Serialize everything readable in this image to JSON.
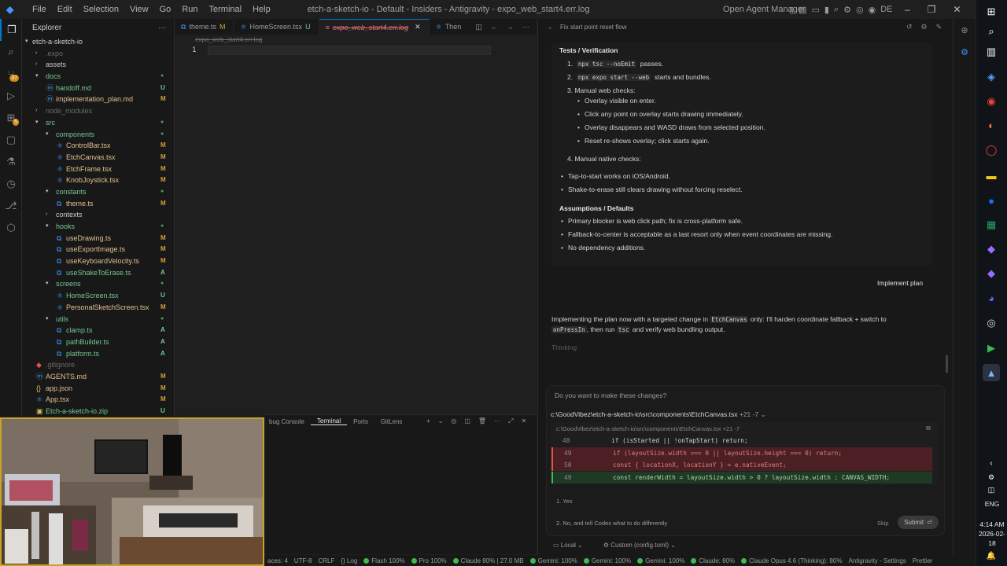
{
  "titlebar": {
    "menu": [
      "File",
      "Edit",
      "Selection",
      "View",
      "Go",
      "Run",
      "Terminal",
      "Help"
    ],
    "title": "etch-a-sketch-io - Default - Insiders - Antigravity - expo_web_start4.err.log",
    "agent_manager": "Open Agent Manager",
    "user_initials": "DE"
  },
  "explorer": {
    "header": "Explorer",
    "root": "etch-a-sketch-io",
    "rows": [
      {
        "label": ".expo",
        "depth": 1,
        "kind": "folder",
        "collapsed": true,
        "dim": true,
        "status": ""
      },
      {
        "label": "assets",
        "depth": 1,
        "kind": "folder",
        "collapsed": true,
        "dim": false,
        "status": ""
      },
      {
        "label": "docs",
        "depth": 1,
        "kind": "folder",
        "collapsed": false,
        "dim": false,
        "status": "dot"
      },
      {
        "label": "handoff.md",
        "depth": 2,
        "kind": "md",
        "status": "U"
      },
      {
        "label": "implementation_plan.md",
        "depth": 2,
        "kind": "md",
        "status": "M"
      },
      {
        "label": "node_modules",
        "depth": 1,
        "kind": "folder",
        "collapsed": true,
        "dim": true,
        "status": ""
      },
      {
        "label": "src",
        "depth": 1,
        "kind": "folder",
        "collapsed": false,
        "dim": false,
        "status": "dot"
      },
      {
        "label": "components",
        "depth": 2,
        "kind": "folder",
        "collapsed": false,
        "status": "dot"
      },
      {
        "label": "ControlBar.tsx",
        "depth": 3,
        "kind": "tsx",
        "status": "M"
      },
      {
        "label": "EtchCanvas.tsx",
        "depth": 3,
        "kind": "tsx",
        "status": "M"
      },
      {
        "label": "EtchFrame.tsx",
        "depth": 3,
        "kind": "tsx",
        "status": "M"
      },
      {
        "label": "KnobJoystick.tsx",
        "depth": 3,
        "kind": "tsx",
        "status": "M"
      },
      {
        "label": "constants",
        "depth": 2,
        "kind": "folder",
        "collapsed": false,
        "status": "dot"
      },
      {
        "label": "theme.ts",
        "depth": 3,
        "kind": "ts",
        "status": "M"
      },
      {
        "label": "contexts",
        "depth": 2,
        "kind": "folder",
        "collapsed": true,
        "status": ""
      },
      {
        "label": "hooks",
        "depth": 2,
        "kind": "folder",
        "collapsed": false,
        "status": "dot"
      },
      {
        "label": "useDrawing.ts",
        "depth": 3,
        "kind": "ts",
        "status": "M"
      },
      {
        "label": "useExportImage.ts",
        "depth": 3,
        "kind": "ts",
        "status": "M"
      },
      {
        "label": "useKeyboardVelocity.ts",
        "depth": 3,
        "kind": "ts",
        "status": "M"
      },
      {
        "label": "useShakeToErase.ts",
        "depth": 3,
        "kind": "ts",
        "status": "A"
      },
      {
        "label": "screens",
        "depth": 2,
        "kind": "folder",
        "collapsed": false,
        "status": "dot"
      },
      {
        "label": "HomeScreen.tsx",
        "depth": 3,
        "kind": "tsx",
        "status": "U"
      },
      {
        "label": "PersonalSketchScreen.tsx",
        "depth": 3,
        "kind": "tsx",
        "status": "M"
      },
      {
        "label": "utils",
        "depth": 2,
        "kind": "folder",
        "collapsed": false,
        "status": "dot"
      },
      {
        "label": "clamp.ts",
        "depth": 3,
        "kind": "ts",
        "status": "A"
      },
      {
        "label": "pathBuilder.ts",
        "depth": 3,
        "kind": "ts",
        "status": "A"
      },
      {
        "label": "platform.ts",
        "depth": 3,
        "kind": "ts",
        "status": "A"
      },
      {
        "label": ".gitignore",
        "depth": 1,
        "kind": "git",
        "dim": true,
        "status": ""
      },
      {
        "label": "AGENTS.md",
        "depth": 1,
        "kind": "md",
        "status": "M"
      },
      {
        "label": "app.json",
        "depth": 1,
        "kind": "json",
        "status": "M"
      },
      {
        "label": "App.tsx",
        "depth": 1,
        "kind": "tsx",
        "status": "M"
      },
      {
        "label": "Etch-a-sketch-io.zip",
        "depth": 1,
        "kind": "zip",
        "status": "U"
      }
    ]
  },
  "tabs": [
    {
      "label": "theme.ts",
      "status": "M",
      "icon": "ts-icon",
      "active": false
    },
    {
      "label": "HomeScreen.tsx",
      "status": "U",
      "icon": "react-icon",
      "active": false
    },
    {
      "label": "expo_web_start4.err.log",
      "status": "",
      "icon": "log-icon",
      "active": true
    },
    {
      "label": "Then",
      "status": "",
      "icon": "react-icon",
      "active": false
    }
  ],
  "editor": {
    "breadcrumb": "expo_web_start4.err.log",
    "line_number": "1"
  },
  "panel": {
    "tabs": [
      "bug Console",
      "Terminal",
      "Ports",
      "GitLens"
    ],
    "active_tab": "Terminal"
  },
  "agent": {
    "header": "Fix start point reset flow",
    "plan": {
      "tests_heading": "Tests / Verification",
      "test1_code": "npx tsc --noEmit",
      "test1_text": "passes.",
      "test2_code": "npx expo start --web",
      "test2_text": "starts and bundles.",
      "test3": "Manual web checks:",
      "web_checks": [
        "Overlay visible on enter.",
        "Click any point on overlay starts drawing immediately.",
        "Overlay disappears and WASD draws from selected position.",
        "Reset re-shows overlay; click starts again."
      ],
      "test4": "Manual native checks:",
      "native_checks": [
        "Tap-to-start works on iOS/Android.",
        "Shake-to-erase still clears drawing without forcing reselect."
      ],
      "assumptions_heading": "Assumptions / Defaults",
      "assumptions": [
        "Primary blocker is web click path; fix is cross-platform safe.",
        "Fallback-to-center is acceptable as a last resort only when event coordinates are missing.",
        "No dependency additions."
      ]
    },
    "implement_label": "Implement plan",
    "impl_text_1": "Implementing the plan now with a targeted change in",
    "impl_code_1": "EtchCanvas",
    "impl_text_2": "only: I'll harden coordinate fallback + switch to",
    "impl_code_2": "onPressIn",
    "impl_text_3": ", then run",
    "impl_code_3": "tsc",
    "impl_text_4": "and verify web bundling output.",
    "thinking": "Thinking",
    "approval": {
      "question": "Do you want to make these changes?",
      "file_path": "c:\\GoodVibez\\etch-a-sketch-io\\src\\components\\EtchCanvas.tsx",
      "diff_stat": "+21 -7",
      "diff_header": "c:\\GoodVibez\\etch-a-sketch-io\\src\\components\\EtchCanvas.tsx  +21 -7",
      "diff_lines": [
        {
          "n": "48",
          "type": "ctx",
          "code": "if (isStarted || !onTapStart) return;"
        },
        {
          "n": "49",
          "type": "del",
          "code": "if (layoutSize.width === 0 || layoutSize.height === 0) return;"
        },
        {
          "n": "50",
          "type": "del",
          "code": "const { locationX, locationY } = e.nativeEvent;"
        },
        {
          "n": "49",
          "type": "add",
          "code": "const renderWidth = layoutSize.width > 0 ? layoutSize.width : CANVAS_WIDTH;"
        }
      ],
      "option1": "1. Yes",
      "option2": "2. No, and tell Codex what to do differently",
      "skip": "Skip",
      "submit": "Submit"
    },
    "footer_local": "Local",
    "footer_config": "Custom (config.toml)"
  },
  "statusbar": {
    "items": [
      "aces: 4",
      "UTF-8",
      "CRLF",
      "{} Log",
      "Flash 100%",
      "Pro 100%",
      "Claude 80% | 27.0 MB",
      "Gemini: 100%",
      "Gemini: 100%",
      "Gemini: 100%",
      "Claude: 80%",
      "Claude Opus 4.6 (Thinking): 80%",
      "Antigravity - Settings",
      "Prettier"
    ]
  },
  "taskbar": {
    "lang": "ENG",
    "time": "4:14 AM",
    "date": "2026-02-18"
  },
  "colors": {
    "accent": "#0078d4",
    "modified": "#d1a03a",
    "untracked": "#73c991",
    "diff_del": "#4b1f24",
    "diff_add": "#1f3a24"
  }
}
